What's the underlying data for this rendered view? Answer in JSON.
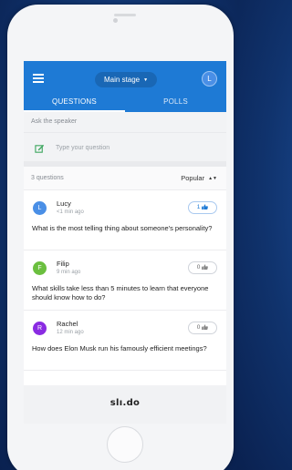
{
  "app": {
    "event_name": "Main stage",
    "user_initial": "L",
    "colors": {
      "primary": "#1e7ad5",
      "accent_green": "#3aa55c"
    }
  },
  "tabs": [
    {
      "label": "QUESTIONS",
      "active": true
    },
    {
      "label": "POLLS",
      "active": false
    }
  ],
  "ask": {
    "label": "Ask the speaker",
    "placeholder": "Type your question"
  },
  "list": {
    "count_label": "3 questions",
    "sort": "Popular"
  },
  "questions": [
    {
      "initial": "L",
      "avatar_color": "#4a8fe6",
      "name": "Lucy",
      "time": "<1 min ago",
      "likes": "1",
      "liked": true,
      "text": "What is the most telling thing about someone's personality?"
    },
    {
      "initial": "F",
      "avatar_color": "#6bbf3f",
      "name": "Filip",
      "time": "9 min ago",
      "likes": "0",
      "liked": false,
      "text": "What skills take less than 5 minutes to learn that everyone should know how to do?"
    },
    {
      "initial": "R",
      "avatar_color": "#8a2be2",
      "name": "Rachel",
      "time": "12 min ago",
      "likes": "0",
      "liked": false,
      "text": "How does Elon Musk run his famously efficient meetings?"
    }
  ],
  "footer": {
    "brand": "slı.do"
  }
}
